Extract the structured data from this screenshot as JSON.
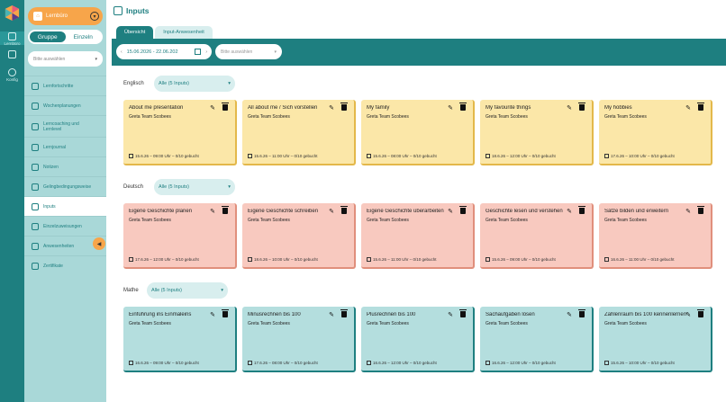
{
  "rail": {
    "items": [
      {
        "label": "Lernbüro"
      },
      {
        "label": "Konfig"
      }
    ]
  },
  "sidebar": {
    "school_label": "Lernbüro",
    "toggle": {
      "group": "Gruppe",
      "single": "Einzeln"
    },
    "select_placeholder": "Bitte auswählen",
    "nav": [
      {
        "label": "Lernfortschritte"
      },
      {
        "label": "Wochenplanungen"
      },
      {
        "label": "Lerncoaching und Lernlevel"
      },
      {
        "label": "Lernjournal"
      },
      {
        "label": "Notizen"
      },
      {
        "label": "Gelingbedingungsweise"
      },
      {
        "label": "Inputs"
      },
      {
        "label": "Einzelzuweisungen"
      },
      {
        "label": "Anwesenheiten"
      },
      {
        "label": "Zertifikate"
      }
    ]
  },
  "main": {
    "title": "Inputs",
    "tabs": [
      {
        "label": "Übersicht"
      },
      {
        "label": "Input-Anwesenheit"
      }
    ],
    "date_range": "15.06.2026 - 22.06.202",
    "filter_placeholder": "Bitte auswählen",
    "sections": [
      {
        "name": "Englisch",
        "filter": "Alle (5 Inputs)",
        "cards": [
          {
            "title": "About me presentation",
            "owner": "Greta Team Scobees",
            "meta": "15.6.26 – 09:00 Uhr – 0/10 gebucht"
          },
          {
            "title": "All about me / Sich vorstellen",
            "owner": "Greta Team Scobees",
            "meta": "15.6.26 – 11:00 Uhr – 0/10 gebucht"
          },
          {
            "title": "My family",
            "owner": "Greta Team Scobees",
            "meta": "15.6.26 – 08:00 Uhr – 0/10 gebucht"
          },
          {
            "title": "My favourite things",
            "owner": "Greta Team Scobees",
            "meta": "18.6.26 – 12:00 Uhr – 0/10 gebucht"
          },
          {
            "title": "My hobbies",
            "owner": "Greta Team Scobees",
            "meta": "17.6.26 – 10:00 Uhr – 0/10 gebucht"
          }
        ]
      },
      {
        "name": "Deutsch",
        "filter": "Alle (5 Inputs)",
        "cards": [
          {
            "title": "Eigene Geschichte planen",
            "owner": "Greta Team Scobees",
            "meta": "17.6.26 – 12:00 Uhr – 0/10 gebucht"
          },
          {
            "title": "Eigene Geschichte schreiben",
            "owner": "Greta Team Scobees",
            "meta": "18.6.26 – 10:00 Uhr – 0/10 gebucht"
          },
          {
            "title": "Eigene Geschichte überarbeiten",
            "owner": "Greta Team Scobees",
            "meta": "15.6.26 – 11:00 Uhr – 0/10 gebucht"
          },
          {
            "title": "Geschichte lesen und verstehen",
            "owner": "Greta Team Scobees",
            "meta": "15.6.26 – 09:00 Uhr – 0/10 gebucht"
          },
          {
            "title": "Sätze bilden und erweitern",
            "owner": "Greta Team Scobees",
            "meta": "16.6.26 – 11:00 Uhr – 0/10 gebucht"
          }
        ]
      },
      {
        "name": "Mathe",
        "filter": "Alle (5 Inputs)",
        "cards": [
          {
            "title": "Einführung ins Einmaleins",
            "owner": "Greta Team Scobees",
            "meta": "16.6.26 – 09:00 Uhr – 0/10 gebucht"
          },
          {
            "title": "Minusrechnen bis 100",
            "owner": "Greta Team Scobees",
            "meta": "17.6.26 – 08:00 Uhr – 0/10 gebucht"
          },
          {
            "title": "Plusrechnen bis 100",
            "owner": "Greta Team Scobees",
            "meta": "16.6.26 – 12:00 Uhr – 0/10 gebucht"
          },
          {
            "title": "Sachaufgaben lösen",
            "owner": "Greta Team Scobees",
            "meta": "16.6.26 – 12:00 Uhr – 0/10 gebucht"
          },
          {
            "title": "Zahlenraum bis 100 kennenlernen",
            "owner": "Greta Team Scobees",
            "meta": "15.6.26 – 10:00 Uhr – 0/10 gebucht"
          }
        ]
      }
    ]
  },
  "colors": {
    "primary": "#1e7f80",
    "accent": "#f7a54a",
    "sidebar": "#a9d8d8",
    "card_yellow": "#fbe7a8",
    "card_red": "#f8c9bf",
    "card_teal": "#b4dede"
  }
}
